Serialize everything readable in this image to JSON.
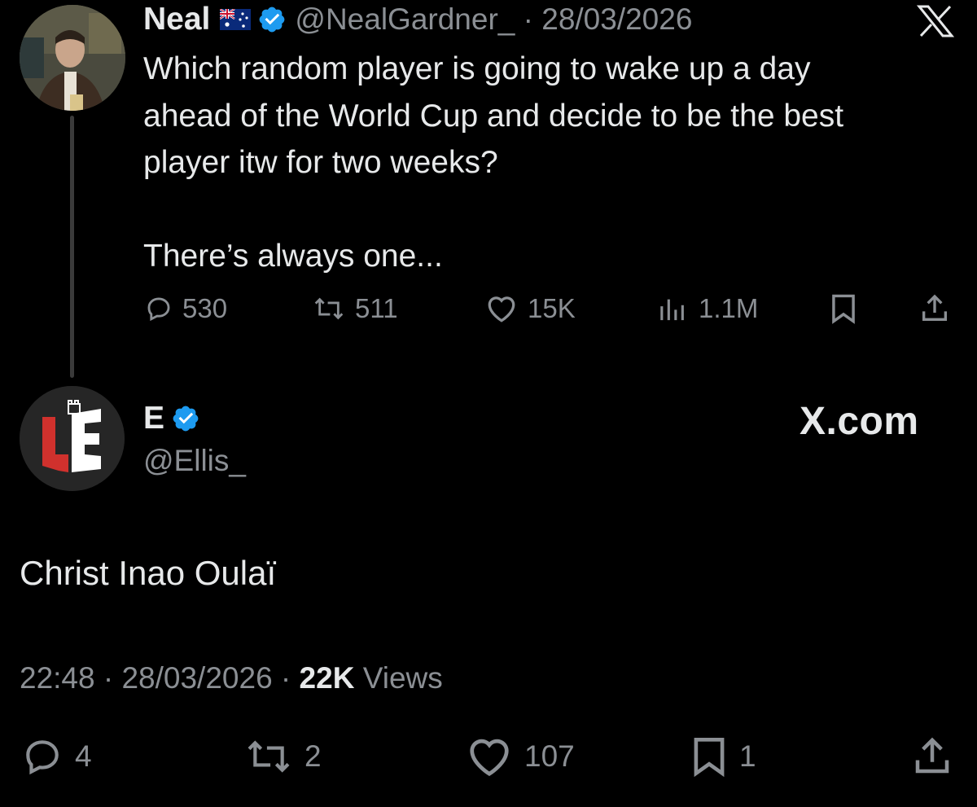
{
  "parent_tweet": {
    "name": "Neal",
    "flag_icon": "australia-flag-icon",
    "handle_date": "@NealGardner_ · 28/03/2026",
    "text": "Which random player is going to wake up a day\nahead of the World Cup and decide to be the best\nplayer itw for two weeks?\n\nThere’s always one...",
    "actions": {
      "replies": "530",
      "reposts": "511",
      "likes": "15K",
      "views": "1.1M"
    }
  },
  "reply_tweet": {
    "name": "E",
    "handle": "@Ellis_",
    "watermark": "X.com",
    "text": "Christ Inao Oulaï",
    "meta": {
      "time_date": "22:48 · 28/03/2026 · ",
      "views_count": "22K",
      "views_label": " Views"
    },
    "actions": {
      "replies": "4",
      "reposts": "2",
      "likes": "107",
      "bookmarks": "1"
    }
  },
  "colors": {
    "background": "#000000",
    "text": "#e7e9ea",
    "muted": "#8b8f94",
    "verified": "#1d9bf0",
    "avatar_logo_red": "#d0312d"
  }
}
